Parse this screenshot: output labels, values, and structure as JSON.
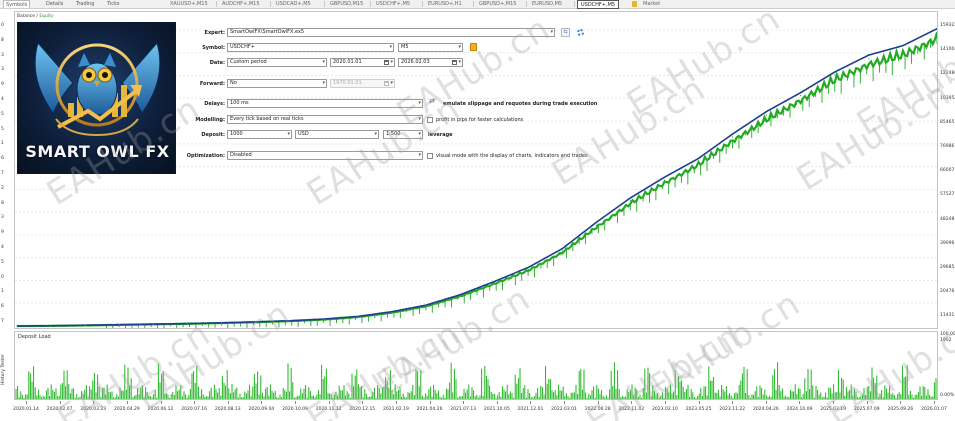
{
  "left_tabs": [
    "Symbols",
    "Details",
    "Trading",
    "Ticks"
  ],
  "chart_tabs": [
    "XAUUSD+,M15",
    "AUDCHF+,M15",
    "USDCAD+,M5",
    "GBPUSD,M15",
    "USDCHF+,M5",
    "EURUSD+,H1",
    "GBPUSD+,M15",
    "EURUSD,M5",
    "USDCHF+,M5"
  ],
  "active_chart_tab": 8,
  "market_label": "Market",
  "legend": {
    "balance": "Balance",
    "separator": " / ",
    "equity": "Equity"
  },
  "deposit_load_label": "Deposit Load",
  "side_label": "History Tester",
  "logo": {
    "text": "SMART OWL FX"
  },
  "settings": {
    "expert": {
      "label": "Expert:",
      "value": "SmartOwlFX\\SmartOwlFX.ex5"
    },
    "symbol": {
      "label": "Symbol:",
      "value": "USDCHF+",
      "timeframe": "M5"
    },
    "date": {
      "label": "Date:",
      "period": "Custom period",
      "from": "2020.01.01",
      "to": "2026.02.03"
    },
    "forward": {
      "label": "Forward:",
      "value": "No",
      "date": "1970.01.01"
    },
    "delays": {
      "label": "Delays:",
      "value": "100 ms",
      "check_text": "emulate slippage and requotes during trade execution"
    },
    "modelling": {
      "label": "Modelling:",
      "value": "Every tick based on real ticks",
      "check_text": "profit in pips for faster calculations"
    },
    "deposit": {
      "label": "Deposit:",
      "amount": "1000",
      "currency": "USD",
      "leverage": "1:500",
      "leverage_label": "leverage"
    },
    "optimization": {
      "label": "Optimization:",
      "value": "Disabled",
      "check_text": "visual mode with the display of charts, indicators and trades"
    }
  },
  "y_axis_right": [
    "159322",
    "141004",
    "122486",
    "103952",
    "85465",
    "76986",
    "66007",
    "57527",
    "48248",
    "39096",
    "29685",
    "20476",
    "11431",
    "1902"
  ],
  "y_axis_bottom": [
    "100.00%",
    "0.00%"
  ],
  "y_axis_left": [
    "0",
    "8",
    "3",
    "3",
    "9",
    "4",
    "5",
    "5",
    "1",
    "6",
    "7",
    "2",
    "8",
    "3",
    "9",
    "4",
    "5",
    "0",
    "1",
    "6",
    "7"
  ],
  "watermark": "EAHub.cn",
  "colors": {
    "balance": "#1c3f8c",
    "equity": "#22aa22",
    "deposit_load": "#22b422"
  },
  "chart_data": {
    "type": "line",
    "x": [
      "2020.01.14",
      "2020.02.07",
      "2020.03.23",
      "2020.04.29",
      "2020.06.12",
      "2020.07.16",
      "2020.08.13",
      "2020.09.04",
      "2020.10.09",
      "2020.11.12",
      "2020.12.15",
      "2021.02.19",
      "2021.04.26",
      "2021.07.13",
      "2021.10.05",
      "2021.12.01",
      "2022.03.01",
      "2022.06.28",
      "2022.11.02",
      "2023.02.10",
      "2023.05.25",
      "2023.11.22",
      "2024.04.26",
      "2024.10.09",
      "2025.03.19",
      "2025.07.09",
      "2025.09.26",
      "2026.01.07"
    ],
    "series": [
      {
        "name": "Balance",
        "values": [
          1902,
          2050,
          2300,
          2600,
          2900,
          3200,
          3600,
          4100,
          4700,
          5600,
          7000,
          9500,
          13000,
          18500,
          25500,
          33000,
          43000,
          57000,
          70000,
          81000,
          91000,
          104000,
          116000,
          126000,
          137000,
          146000,
          151000,
          160000
        ]
      },
      {
        "name": "Equity",
        "values": [
          1902,
          2000,
          2250,
          2550,
          2850,
          3150,
          3550,
          4000,
          4600,
          5400,
          6800,
          9200,
          12600,
          18000,
          24800,
          32000,
          41800,
          55500,
          68500,
          79500,
          89500,
          102500,
          114000,
          124500,
          135500,
          144000,
          149000,
          158000
        ]
      }
    ],
    "ylim": [
      1902,
      159322
    ]
  }
}
